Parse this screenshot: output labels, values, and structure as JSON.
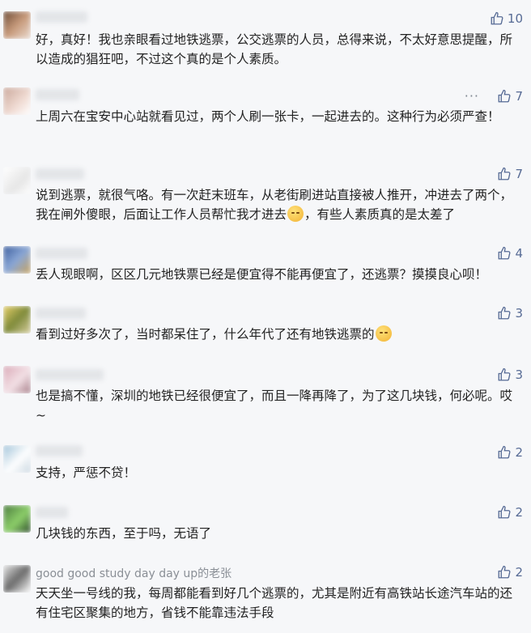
{
  "comments": [
    {
      "nickname": "",
      "text": "好，真好！我也亲眼看过地铁逃票，公交逃票的人员，总得来说，不太好意思提醒，所以造成的猖狂吧，不过这个真的是个人素质。",
      "likes": "10"
    },
    {
      "nickname": "",
      "text": "上周六在宝安中心站就看见过，两个人刷一张卡，一起进去的。这种行为必须严查！",
      "likes": "7"
    },
    {
      "nickname": "",
      "text_before_emoji": "说到逃票，就很气咯。有一次赶末班车，从老街刷进站直接被人推开，冲进去了两个，我在闸外傻眼，后面让工作人员帮忙我才进去",
      "text_after_emoji": "，有些人素质真的是太差了",
      "emoji_name": "embarrassed-emoji",
      "likes": "7"
    },
    {
      "nickname": "",
      "text": "丢人现眼啊，区区几元地铁票已经是便宜得不能再便宜了，还逃票？摸摸良心呗！",
      "likes": "4"
    },
    {
      "nickname": "",
      "text_before_emoji": "看到过好多次了，当时都呆住了，什么年代了还有地铁逃票的",
      "text_after_emoji": "",
      "emoji_name": "sleepy-emoji",
      "likes": "3"
    },
    {
      "nickname": "",
      "text": "也是搞不懂，深圳的地铁已经很便宜了，而且一降再降了，为了这几块钱，何必呢。哎 ~",
      "likes": "3"
    },
    {
      "nickname": "",
      "text": "支持，严惩不贷！",
      "likes": "2"
    },
    {
      "nickname": "",
      "text": "几块钱的东西，至于吗，无语了",
      "likes": "2"
    },
    {
      "nickname": "good good study day day up的老张",
      "text": "天天坐一号线的我，每周都能看到好几个逃票的，尤其是附近有高铁站长途汽车站的还有住宅区聚集的地方，省钱不能靠违法手段",
      "likes": "2"
    }
  ],
  "more_icon": "more-dots-icon",
  "like_icon": "thumbs-up-icon",
  "colors": {
    "accent": "#576b95",
    "text": "#222222",
    "background": "#f6f7f9"
  }
}
